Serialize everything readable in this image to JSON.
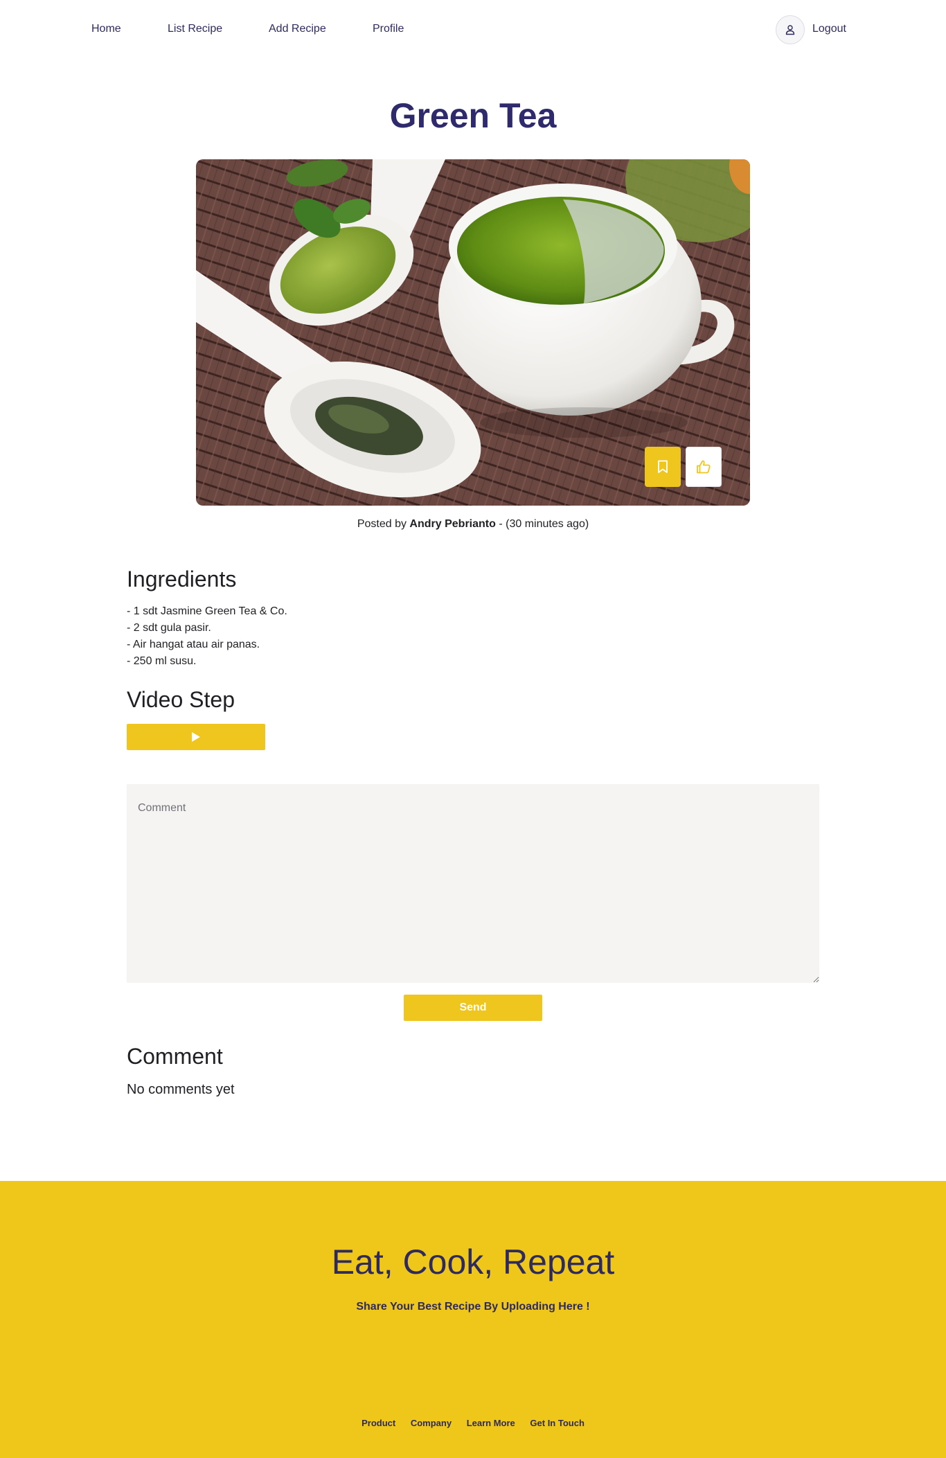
{
  "nav": {
    "home": "Home",
    "list_recipe": "List Recipe",
    "add_recipe": "Add Recipe",
    "profile": "Profile",
    "logout": "Logout"
  },
  "recipe": {
    "title": "Green Tea",
    "posted_prefix": "Posted by",
    "author": "Andry Pebrianto",
    "posted_suffix": "- (30 minutes ago)"
  },
  "ingredients": {
    "heading": "Ingredients",
    "items": [
      "- 1 sdt Jasmine Green Tea & Co.",
      "- 2 sdt gula pasir.",
      "- Air hangat atau air panas.",
      "- 250 ml susu."
    ]
  },
  "video": {
    "heading": "Video Step"
  },
  "comment_form": {
    "placeholder": "Comment",
    "send_label": "Send"
  },
  "comments": {
    "heading": "Comment",
    "empty_text": "No comments yet"
  },
  "footer": {
    "title": "Eat, Cook, Repeat",
    "subtitle": "Share Your Best Recipe By Uploading Here !",
    "links": [
      "Product",
      "Company",
      "Learn More",
      "Get In Touch"
    ]
  },
  "colors": {
    "accent": "#efc61d",
    "brand_text": "#2e2a6b"
  },
  "icons": {
    "avatar": "user-icon",
    "save": "bookmark-icon",
    "like": "thumbs-up-icon",
    "play": "play-icon"
  }
}
